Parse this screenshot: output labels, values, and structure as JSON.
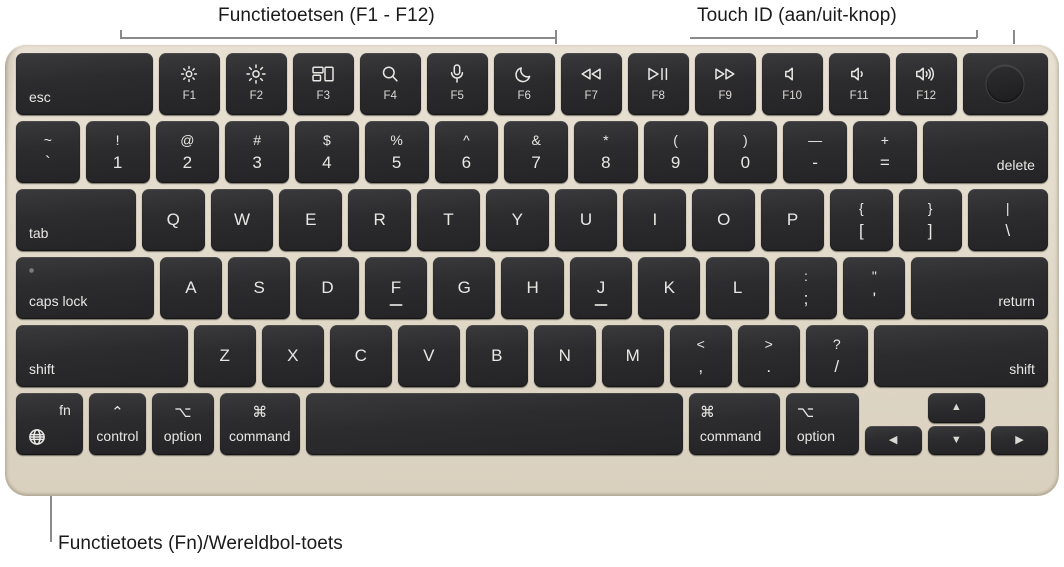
{
  "callouts": {
    "function_keys": "Functietoetsen (F1 - F12)",
    "touch_id": "Touch ID (aan/uit-knop)",
    "globe_key": "Functietoets (Fn)/Wereldbol-toets"
  },
  "colors": {
    "chassis": "#e3dbcb",
    "keycap": "#2c2c2e",
    "legend": "#e9e7e4",
    "leader_line": "#8a8a8a",
    "page_background": "#ffffff"
  },
  "keyboard": {
    "layout": "US ANSI MacBook Air",
    "rows": {
      "function_row": [
        {
          "label": "esc",
          "icon": ""
        },
        {
          "label": "F1",
          "icon": "brightness-down-icon"
        },
        {
          "label": "F2",
          "icon": "brightness-up-icon"
        },
        {
          "label": "F3",
          "icon": "mission-control-icon"
        },
        {
          "label": "F4",
          "icon": "spotlight-search-icon"
        },
        {
          "label": "F5",
          "icon": "dictation-microphone-icon"
        },
        {
          "label": "F6",
          "icon": "do-not-disturb-moon-icon"
        },
        {
          "label": "F7",
          "icon": "rewind-icon"
        },
        {
          "label": "F8",
          "icon": "play-pause-icon"
        },
        {
          "label": "F9",
          "icon": "fast-forward-icon"
        },
        {
          "label": "F10",
          "icon": "volume-mute-icon"
        },
        {
          "label": "F11",
          "icon": "volume-down-icon"
        },
        {
          "label": "F12",
          "icon": "volume-up-icon"
        },
        {
          "label": "",
          "icon": "touch-id-button"
        }
      ],
      "number_row": [
        {
          "top": "~",
          "bottom": "`"
        },
        {
          "top": "!",
          "bottom": "1"
        },
        {
          "top": "@",
          "bottom": "2"
        },
        {
          "top": "#",
          "bottom": "3"
        },
        {
          "top": "$",
          "bottom": "4"
        },
        {
          "top": "%",
          "bottom": "5"
        },
        {
          "top": "^",
          "bottom": "6"
        },
        {
          "top": "&",
          "bottom": "7"
        },
        {
          "top": "*",
          "bottom": "8"
        },
        {
          "top": "(",
          "bottom": "9"
        },
        {
          "top": ")",
          "bottom": "0"
        },
        {
          "top": "—",
          "bottom": "-"
        },
        {
          "top": "+",
          "bottom": "="
        },
        {
          "top": "",
          "bottom": "delete"
        }
      ],
      "qwerty_row": [
        {
          "top": "",
          "bottom": "tab"
        },
        {
          "top": "",
          "bottom": "Q"
        },
        {
          "top": "",
          "bottom": "W"
        },
        {
          "top": "",
          "bottom": "E"
        },
        {
          "top": "",
          "bottom": "R"
        },
        {
          "top": "",
          "bottom": "T"
        },
        {
          "top": "",
          "bottom": "Y"
        },
        {
          "top": "",
          "bottom": "U"
        },
        {
          "top": "",
          "bottom": "I"
        },
        {
          "top": "",
          "bottom": "O"
        },
        {
          "top": "",
          "bottom": "P"
        },
        {
          "top": "{",
          "bottom": "["
        },
        {
          "top": "}",
          "bottom": "]"
        },
        {
          "top": "|",
          "bottom": "\\"
        }
      ],
      "home_row": [
        {
          "top": "",
          "bottom": "caps lock"
        },
        {
          "top": "",
          "bottom": "A"
        },
        {
          "top": "",
          "bottom": "S"
        },
        {
          "top": "",
          "bottom": "D"
        },
        {
          "top": "",
          "bottom": "F"
        },
        {
          "top": "",
          "bottom": "G"
        },
        {
          "top": "",
          "bottom": "H"
        },
        {
          "top": "",
          "bottom": "J"
        },
        {
          "top": "",
          "bottom": "K"
        },
        {
          "top": "",
          "bottom": "L"
        },
        {
          "top": ":",
          "bottom": ";"
        },
        {
          "top": "\"",
          "bottom": "'"
        },
        {
          "top": "",
          "bottom": "return"
        }
      ],
      "shift_row": [
        {
          "top": "",
          "bottom": "shift"
        },
        {
          "top": "",
          "bottom": "Z"
        },
        {
          "top": "",
          "bottom": "X"
        },
        {
          "top": "",
          "bottom": "C"
        },
        {
          "top": "",
          "bottom": "V"
        },
        {
          "top": "",
          "bottom": "B"
        },
        {
          "top": "",
          "bottom": "N"
        },
        {
          "top": "",
          "bottom": "M"
        },
        {
          "top": "<",
          "bottom": ","
        },
        {
          "top": ">",
          "bottom": "."
        },
        {
          "top": "?",
          "bottom": "/"
        },
        {
          "top": "",
          "bottom": "shift"
        }
      ],
      "bottom_row": [
        {
          "symbol": "",
          "word": "fn",
          "icon": "globe-icon"
        },
        {
          "symbol": "⌃",
          "word": "control"
        },
        {
          "symbol": "⌥",
          "word": "option"
        },
        {
          "symbol": "⌘",
          "word": "command"
        },
        {
          "symbol": "",
          "word": ""
        },
        {
          "symbol": "⌘",
          "word": "command"
        },
        {
          "symbol": "⌥",
          "word": "option"
        },
        {
          "symbol": "◀",
          "word": "left-arrow"
        },
        {
          "symbol": "▲",
          "word": "up-arrow"
        },
        {
          "symbol": "▼",
          "word": "down-arrow"
        },
        {
          "symbol": "▶",
          "word": "right-arrow"
        }
      ]
    }
  }
}
